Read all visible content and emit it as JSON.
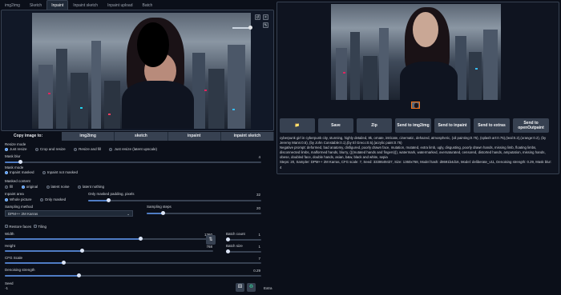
{
  "tabs": [
    "img2img",
    "Sketch",
    "Inpaint",
    "Inpaint sketch",
    "Inpaint upload",
    "Batch"
  ],
  "active_tab": "Inpaint",
  "canvas_controls": {
    "undo_icon": "undo-icon",
    "reset_icon": "reset-icon",
    "pen_icon": "pen-icon"
  },
  "copy_image_to": {
    "label": "Copy image to:",
    "buttons": [
      "img2img",
      "sketch",
      "inpaint",
      "inpaint sketch"
    ]
  },
  "resize_mode": {
    "label": "Resize mode",
    "options": [
      "Just resize",
      "Crop and resize",
      "Resize and fill",
      "Just resize (latent upscale)"
    ],
    "selected": "Just resize"
  },
  "mask_blur": {
    "label": "Mask blur",
    "value": "4",
    "fraction": 0.06
  },
  "mask_mode": {
    "label": "Mask mode",
    "options": [
      "Inpaint masked",
      "Inpaint not masked"
    ],
    "selected": "Inpaint masked"
  },
  "masked_content": {
    "label": "Masked content",
    "options": [
      "fill",
      "original",
      "latent noise",
      "latent nothing"
    ],
    "selected": "original"
  },
  "inpaint_area": {
    "label": "Inpaint area",
    "options": [
      "Whole picture",
      "Only masked"
    ],
    "selected": "Whole picture"
  },
  "only_masked_padding": {
    "label": "Only masked padding, pixels",
    "value": "32",
    "fraction": 0.12
  },
  "sampling_method": {
    "label": "Sampling method",
    "value": "DPM++ 2M Karras"
  },
  "sampling_steps": {
    "label": "Sampling steps",
    "value": "20",
    "fraction": 0.14
  },
  "restore_faces": {
    "label": "Restore faces"
  },
  "tiling": {
    "label": "Tiling"
  },
  "width": {
    "label": "Width",
    "value": "1360",
    "fraction": 0.65
  },
  "height": {
    "label": "Height",
    "value": "768",
    "fraction": 0.37
  },
  "swap_icon": "⇅",
  "batch_count": {
    "label": "Batch count",
    "value": "1",
    "fraction": 0.0
  },
  "batch_size": {
    "label": "Batch size",
    "value": "1",
    "fraction": 0.0
  },
  "cfg_scale": {
    "label": "CFG Scale",
    "value": "7",
    "fraction": 0.23
  },
  "denoising": {
    "label": "Denoising strength",
    "value": "0.29",
    "fraction": 0.29
  },
  "seed": {
    "label": "Seed",
    "value": "-1",
    "extra_label": "Extra"
  },
  "output_buttons": [
    "Save",
    "Zip",
    "Send to img2img",
    "Send to inpaint",
    "Send to extras",
    "Send to openOutpaint"
  ],
  "folder_icon": "📁",
  "generation_info": {
    "prompt": "cyberpunk girl in cyberpunk city, stunning, highly detailed, 8k, ornate, intricate, cinematic, dehazed, atmospheric, (oil painting:0.75), (splash art:0.75),(teal:0.2),(orange:0.2), (by Jeremy Mann:0.5), (by John Constable:0.1),(by El Greco:0.5),(acrylic paint:0.75)",
    "negative": "Negative prompt: deformed, bad anatomy, disfigured, poorly drawn face, mutation, mutated, extra limb, ugly, disgusting, poorly drawn hands, missing limb, floating limbs, disconnected limbs, malformed hands, blurry, (((mutated hands and fingers))), watermark, watermarked, oversaturated, censored, distorted hands, amputation, missing hands, obese, doubled face, double hands, asian, b&w, black and white, sepia",
    "params": "Steps: 20, Sampler: DPM++ 2M Karras, CFG scale: 7, Seed: 3338649437, Size: 1360x768, Model hash: d8691b4d16, Model: deliberate_v11, Denoising strength: 0.29, Mask blur: 4"
  }
}
